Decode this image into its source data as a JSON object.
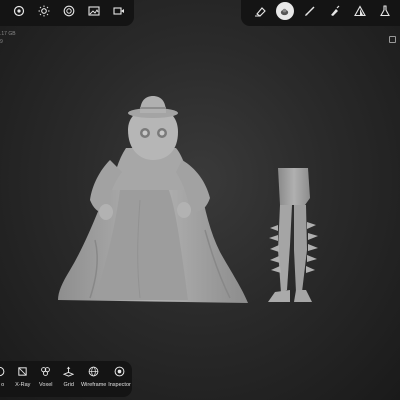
{
  "top_left_toolbar": {
    "icons": [
      "target-icon",
      "sun-icon",
      "material-icon",
      "image-icon",
      "video-icon"
    ]
  },
  "top_right_toolbar": {
    "icons": [
      "eraser-icon",
      "sculpt-brush-icon",
      "pen-icon",
      "smooth-brush-icon",
      "triangle-icon",
      "flask-icon"
    ],
    "active": "sculpt-brush-icon"
  },
  "stats": {
    "line1": ".17 GB",
    "line2": "",
    "line3": "9"
  },
  "bottom_toolbar": {
    "items": [
      {
        "label": "o",
        "icon": "partial-icon"
      },
      {
        "label": "X-Ray",
        "icon": "xray-icon"
      },
      {
        "label": "Voxel",
        "icon": "voxel-icon"
      },
      {
        "label": "Grid",
        "icon": "grid-icon"
      },
      {
        "label": "Wireframe",
        "icon": "wireframe-icon"
      },
      {
        "label": "Inspector",
        "icon": "inspector-icon"
      }
    ]
  },
  "colors": {
    "toolbar_bg": "#141414",
    "model": "#a9a9a9",
    "icon": "#e6e6e6"
  }
}
